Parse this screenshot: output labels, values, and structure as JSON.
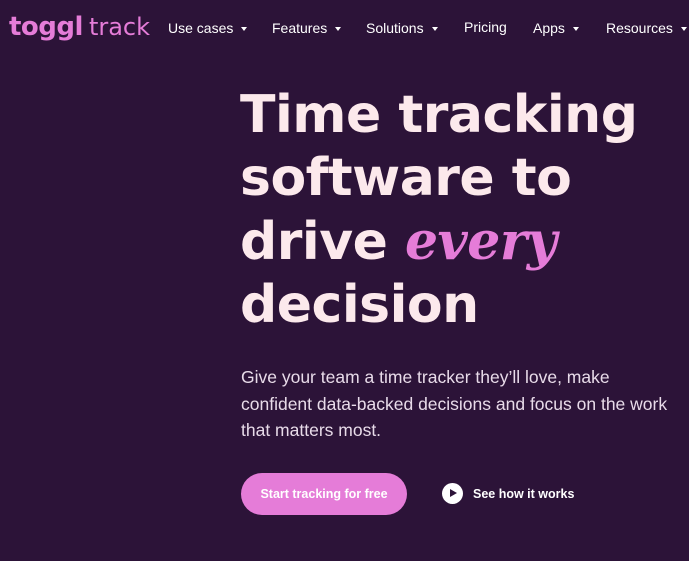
{
  "brand": {
    "logo_word": "toggl",
    "product": "track",
    "accent_color": "#e57cd8",
    "background_color": "#2c1338"
  },
  "nav": {
    "items": [
      {
        "label": "Use cases",
        "has_dropdown": true
      },
      {
        "label": "Features",
        "has_dropdown": true
      },
      {
        "label": "Solutions",
        "has_dropdown": true
      },
      {
        "label": "Pricing",
        "has_dropdown": false
      },
      {
        "label": "Apps",
        "has_dropdown": true
      },
      {
        "label": "Resources",
        "has_dropdown": true
      }
    ]
  },
  "hero": {
    "title_line_1": "Time tracking",
    "title_line_2": "software to",
    "title_line_3_plain": "drive",
    "title_line_3_accent": "every",
    "title_line_4": "decision",
    "subtitle": "Give your team a time tracker they’ll love, make confident data-backed decisions and focus on the work that matters most.",
    "primary_cta": "Start tracking for free",
    "secondary_cta": "See how it works"
  }
}
